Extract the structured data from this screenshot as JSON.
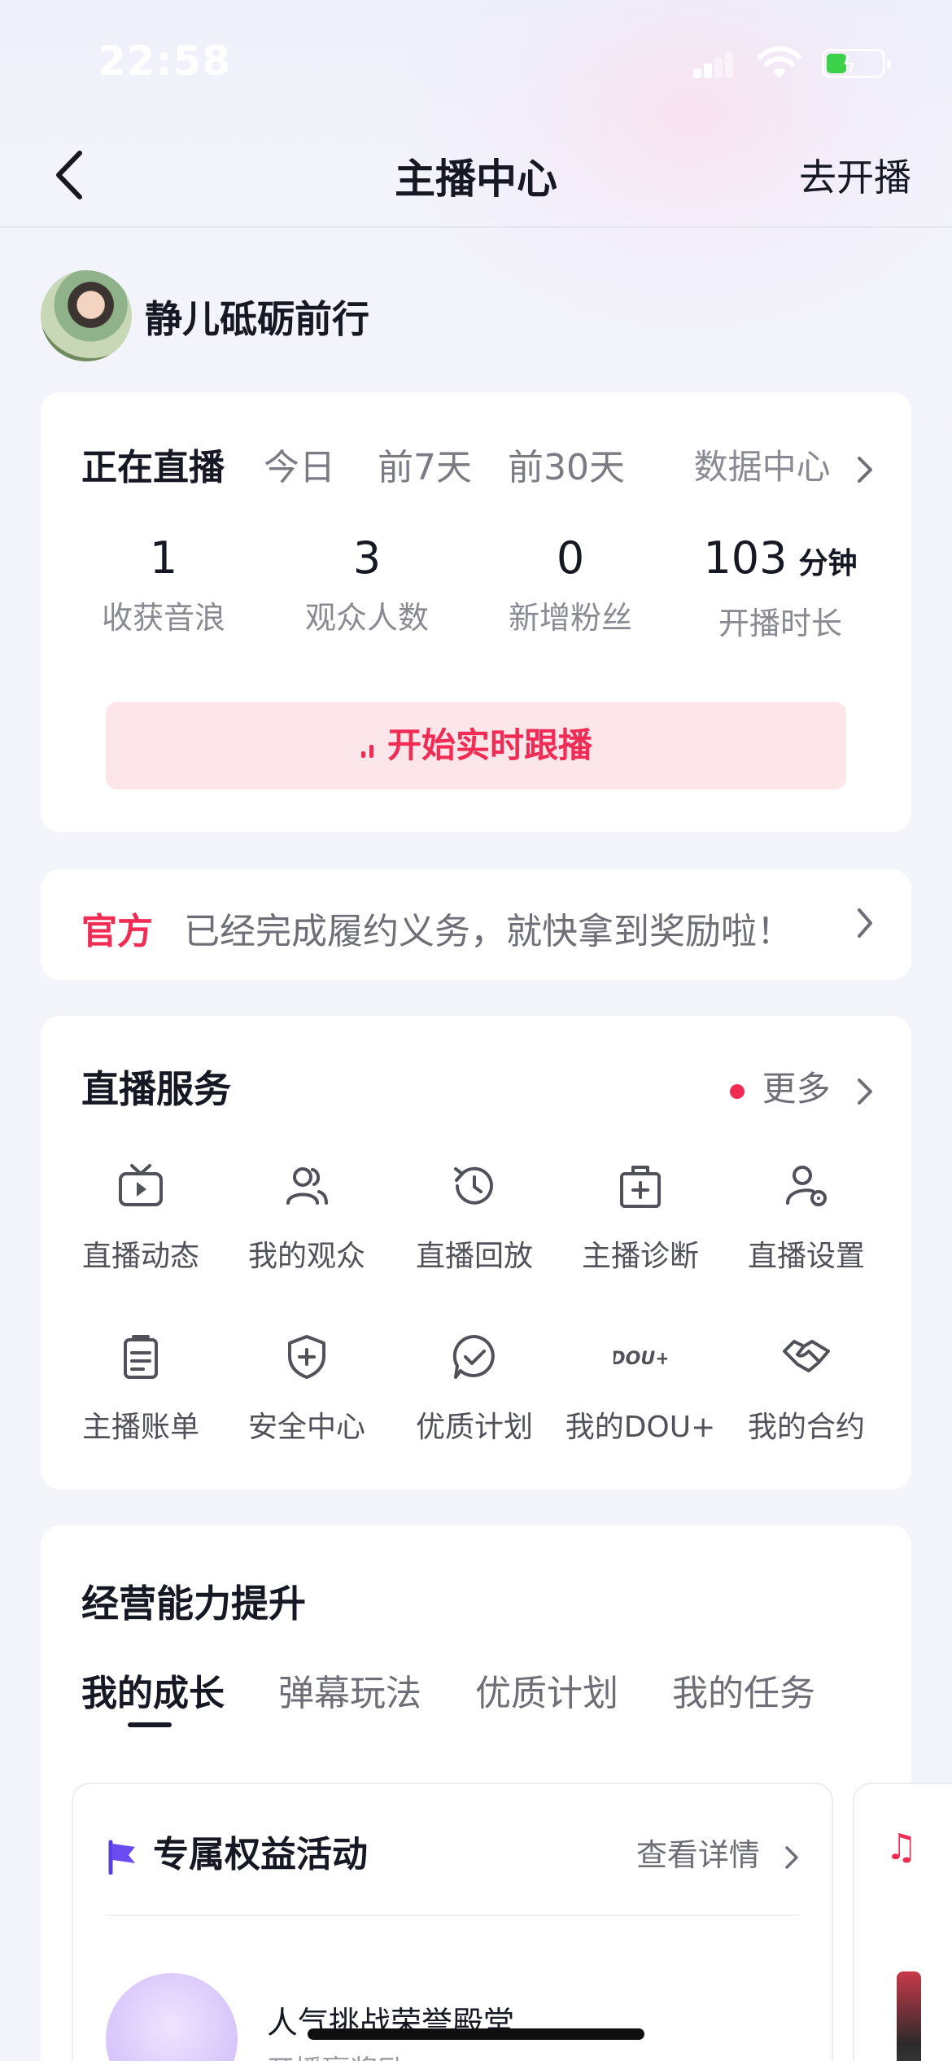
{
  "status_bar": {
    "time": "22:58"
  },
  "nav": {
    "title": "主播中心",
    "right_action": "去开播"
  },
  "profile": {
    "name": "静儿砥砺前行"
  },
  "live_card": {
    "tabs": [
      {
        "label": "正在直播",
        "active": true
      },
      {
        "label": "今日",
        "active": false
      },
      {
        "label": "前7天",
        "active": false
      },
      {
        "label": "前30天",
        "active": false
      }
    ],
    "data_center": "数据中心",
    "stats": [
      {
        "value": "1",
        "unit": "",
        "label": "收获音浪"
      },
      {
        "value": "3",
        "unit": "",
        "label": "观众人数"
      },
      {
        "value": "0",
        "unit": "",
        "label": "新增粉丝"
      },
      {
        "value": "103",
        "unit": "分钟",
        "label": "开播时长"
      }
    ],
    "follow_button": "开始实时跟播"
  },
  "notice": {
    "tag": "官方",
    "text": "已经完成履约义务，就快拿到奖励啦！"
  },
  "services": {
    "title": "直播服务",
    "more": "更多",
    "items": [
      {
        "label": "直播动态",
        "icon": "tv-play-icon"
      },
      {
        "label": "我的观众",
        "icon": "users-icon"
      },
      {
        "label": "直播回放",
        "icon": "history-clock-icon"
      },
      {
        "label": "主播诊断",
        "icon": "medical-kit-icon"
      },
      {
        "label": "直播设置",
        "icon": "user-settings-icon"
      },
      {
        "label": "主播账单",
        "icon": "clipboard-icon"
      },
      {
        "label": "安全中心",
        "icon": "shield-plus-icon"
      },
      {
        "label": "优质计划",
        "icon": "check-chat-icon"
      },
      {
        "label": "我的DOU+",
        "icon": "dou-plus-icon"
      },
      {
        "label": "我的合约",
        "icon": "handshake-icon"
      }
    ]
  },
  "growth": {
    "title": "经营能力提升",
    "tabs": [
      {
        "label": "我的成长",
        "active": true
      },
      {
        "label": "弹幕玩法",
        "active": false
      },
      {
        "label": "优质计划",
        "active": false
      },
      {
        "label": "我的任务",
        "active": false
      }
    ],
    "card": {
      "title": "专属权益活动",
      "detail_link": "查看详情",
      "item_title": "人气挑战荣誉殿堂",
      "item_subtitle": "开播赢奖励"
    }
  },
  "colors": {
    "accent": "#f02c55",
    "accent_bg": "#fde6ea",
    "text_primary": "#161823",
    "text_secondary": "#8a8b92"
  }
}
